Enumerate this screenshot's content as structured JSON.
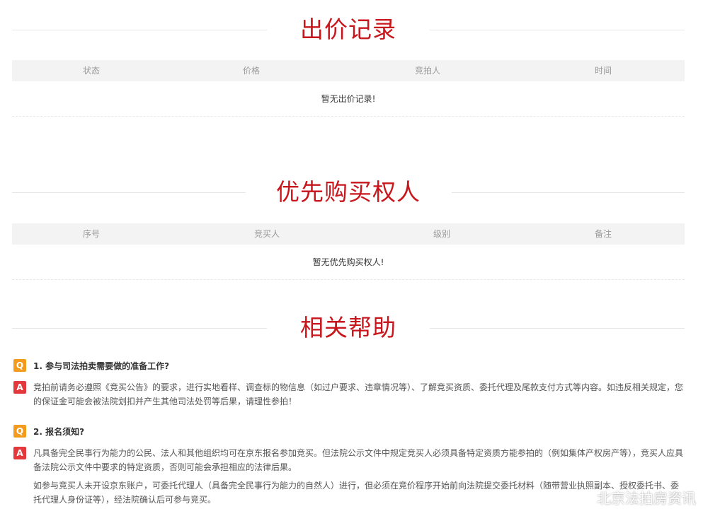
{
  "bids": {
    "title": "出价记录",
    "headers": [
      "状态",
      "价格",
      "竞拍人",
      "时间"
    ],
    "empty": "暂无出价记录!"
  },
  "priority": {
    "title": "优先购买权人",
    "headers": [
      "序号",
      "竞买人",
      "级别",
      "备注"
    ],
    "empty": "暂无优先购买权人!"
  },
  "help": {
    "title": "相关帮助",
    "q_badge": "Q",
    "a_badge": "A",
    "items": [
      {
        "question": "1. 参与司法拍卖需要做的准备工作?",
        "answers": [
          "竞拍前请务必遵照《竞买公告》的要求，进行实地看样、调查标的物信息（如过户要求、违章情况等）、了解竞买资质、委托代理及尾款支付方式等内容。如违反相关规定，您的保证金可能会被法院划扣并产生其他司法处罚等后果，请理性参拍！"
        ]
      },
      {
        "question": "2. 报名须知?",
        "answers": [
          "凡具备完全民事行为能力的公民、法人和其他组织均可在京东报名参加竞买。但法院公示文件中规定竞买人必须具备特定资质方能参拍的（例如集体产权房产等），竞买人应具备法院公示文件中要求的特定资质，否则可能会承担相应的法律后果。",
          "如参与竞买人未开设京东账户，可委托代理人（具备完全民事行为能力的自然人）进行，但必须在竞价程序开始前向法院提交委托材料（随带营业执照副本、授权委托书、委托代理人身份证等），经法院确认后可参与竞买。"
        ]
      }
    ]
  },
  "watermark": {
    "text": "北京法拍房资讯",
    "icon": "weibo-icon"
  },
  "colors": {
    "accent": "#c8161d",
    "q_badge": "#f29b1d",
    "a_badge": "#e4393c",
    "header_bg": "#f3f3f3"
  }
}
